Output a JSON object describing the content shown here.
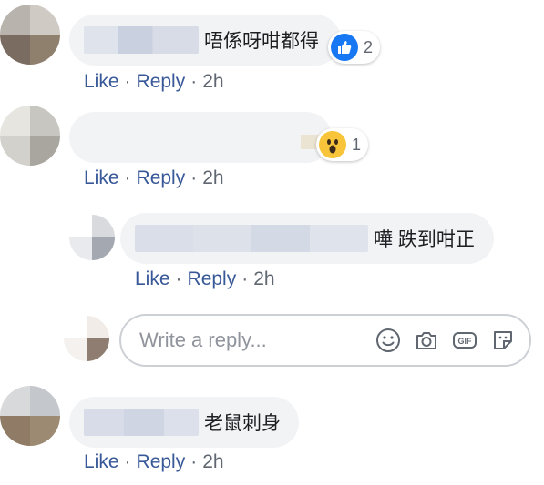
{
  "comments": [
    {
      "text": "唔係呀咁都得",
      "reaction_count": "2",
      "like": "Like",
      "reply": "Reply",
      "time": "2h",
      "reaction": "like-icon"
    },
    {
      "text": "",
      "reaction_count": "1",
      "like": "Like",
      "reply": "Reply",
      "time": "2h",
      "reaction": "wow-icon"
    },
    {
      "text": "老鼠刺身",
      "like": "Like",
      "reply": "Reply",
      "time": "2h"
    }
  ],
  "reply": {
    "text": "嘩 跌到咁正",
    "like": "Like",
    "reply": "Reply",
    "time": "2h"
  },
  "reply_input": {
    "placeholder": "Write a reply..."
  },
  "icons": {
    "emoji": "smile-icon",
    "camera": "camera-icon",
    "gif": "gif-icon",
    "sticker": "sticker-icon"
  },
  "colors": {
    "link": "#385898",
    "bubble": "#f2f3f5",
    "like_blue": "#1877f2",
    "wow_yellow": "#f7c43a"
  }
}
